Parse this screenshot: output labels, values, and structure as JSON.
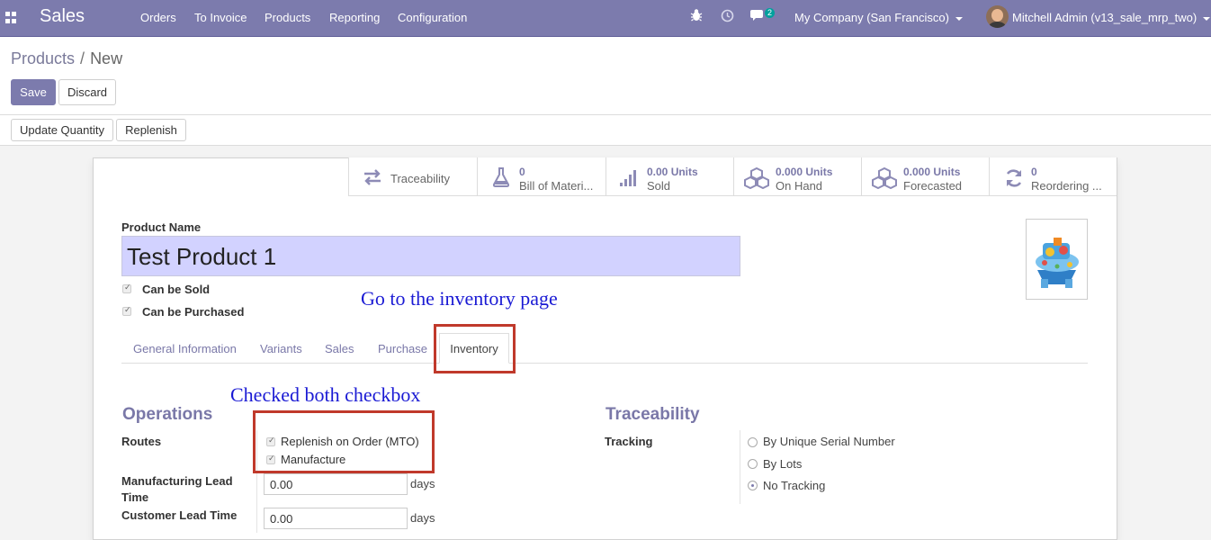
{
  "navbar": {
    "app_name": "Sales",
    "menu": [
      "Orders",
      "To Invoice",
      "Products",
      "Reporting",
      "Configuration"
    ],
    "chat_count": "2",
    "company": "My Company (San Francisco)",
    "user": "Mitchell Admin (v13_sale_mrp_two)",
    "icons": [
      "apps-grid-icon",
      "bug-icon",
      "clock-icon",
      "chat-icon"
    ]
  },
  "breadcrumb": {
    "parent": "Products",
    "separator": "/",
    "current": "New"
  },
  "buttons": {
    "save": "Save",
    "discard": "Discard",
    "update_quantity": "Update Quantity",
    "replenish": "Replenish"
  },
  "smart_buttons": [
    {
      "icon": "arrows-exchange-icon",
      "label": "Traceability"
    },
    {
      "icon": "flask-icon",
      "value": "0",
      "label": "Bill of Materi..."
    },
    {
      "icon": "bar-chart-icon",
      "value": "0.00 Units",
      "label": "Sold"
    },
    {
      "icon": "cubes-icon",
      "value": "0.000 Units",
      "label": "On Hand"
    },
    {
      "icon": "cubes-icon",
      "value": "0.000 Units",
      "label": "Forecasted"
    },
    {
      "icon": "refresh-icon",
      "value": "0",
      "label": "Reordering ..."
    }
  ],
  "form": {
    "product_name_label": "Product Name",
    "product_name": "Test Product 1",
    "can_be_sold": "Can be Sold",
    "can_be_purchased": "Can be Purchased"
  },
  "tabs": [
    "General Information",
    "Variants",
    "Sales",
    "Purchase",
    "Inventory"
  ],
  "operations": {
    "title": "Operations",
    "routes_label": "Routes",
    "routes": [
      "Replenish on Order (MTO)",
      "Manufacture"
    ],
    "mfg_lead_label_1": "Manufacturing Lead",
    "mfg_lead_label_2": "Time",
    "mfg_lead_value": "0.00",
    "customer_lead_label": "Customer Lead Time",
    "customer_lead_value": "0.00",
    "unit": "days"
  },
  "traceability": {
    "title": "Traceability",
    "tracking_label": "Tracking",
    "options": [
      "By Unique Serial Number",
      "By Lots",
      "No Tracking"
    ],
    "selected": "No Tracking"
  },
  "annotations": {
    "inventory_hint": "Go to the inventory page",
    "checkbox_hint": "Checked both checkbox"
  },
  "colors": {
    "brand": "#7c7bad",
    "annotation_text": "#1a1ad4",
    "annotation_box": "#c0392b",
    "name_field": "#d2d2ff"
  }
}
